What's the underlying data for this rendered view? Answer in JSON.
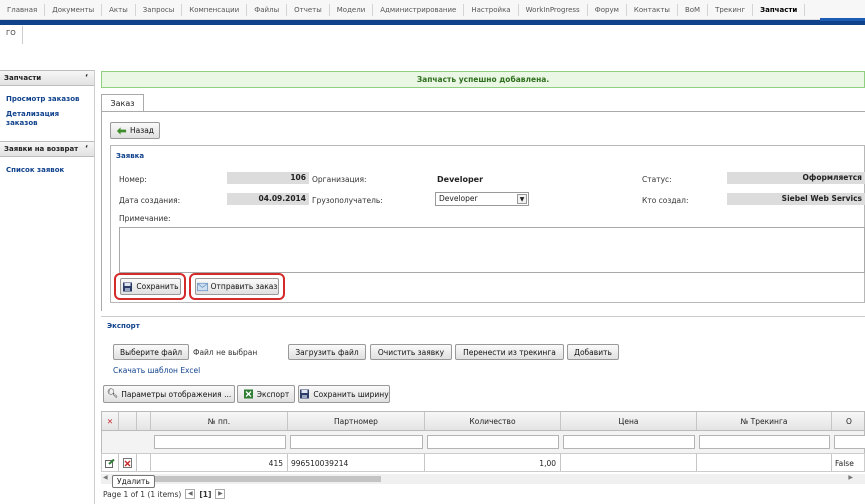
{
  "nav": {
    "items": [
      "Главная",
      "Документы",
      "Акты",
      "Запросы",
      "Компенсации",
      "Файлы",
      "Отчеты",
      "Модели",
      "Администрирование",
      "Настройка",
      "WorkInProgress",
      "Форум",
      "Контакты",
      "BoM",
      "Трекинг",
      "Запчасти"
    ],
    "active": "Запчасти"
  },
  "breadcrumb": "ГО",
  "sidebar": {
    "group1": {
      "title": "Запчасти",
      "links": [
        "Просмотр заказов",
        "Детализация заказов"
      ]
    },
    "group2": {
      "title": "Заявки на возврат",
      "links": [
        "Список заявок"
      ]
    }
  },
  "success_message": "Запчасть успешно добавлена.",
  "tab_label": "Заказ",
  "back_button": "Назад",
  "order": {
    "legend": "Заявка",
    "number_label": "Номер:",
    "number_value": "106",
    "org_label": "Организация:",
    "org_value": "Developer",
    "status_label": "Статус:",
    "status_value": "Оформляется",
    "created_label": "Дата создания:",
    "created_value": "04.09.2014",
    "consignee_label": "Грузополучатель:",
    "consignee_value": "Developer",
    "creator_label": "Кто создал:",
    "creator_value": "Siebel Web Servics",
    "note_label": "Примечание:"
  },
  "actions": {
    "save": "Сохранить",
    "send": "Отправить заказ"
  },
  "export": {
    "title": "Экспорт",
    "choose_file": "Выберите файл",
    "no_file": "Файл не выбран",
    "upload": "Загрузить файл",
    "clear": "Очистить заявку",
    "move": "Перенести из трекинга",
    "add": "Добавить",
    "template_link": "Скачать шаблон Excel"
  },
  "grid_toolbar": {
    "display": "Параметры отображения ...",
    "export": "Экспорт",
    "save_width": "Сохранить ширину"
  },
  "grid": {
    "columns": [
      "№ пп.",
      "Партномер",
      "Количество",
      "Цена",
      "№ Трекинга",
      "О"
    ],
    "rows": [
      {
        "num": "415",
        "part": "996510039214",
        "qty": "1,00",
        "price": "",
        "tracking": "",
        "o": "False"
      }
    ]
  },
  "tooltip": "Удалить",
  "pager": {
    "text": "Page 1 of 1 (1 items)",
    "page": "[1]"
  }
}
